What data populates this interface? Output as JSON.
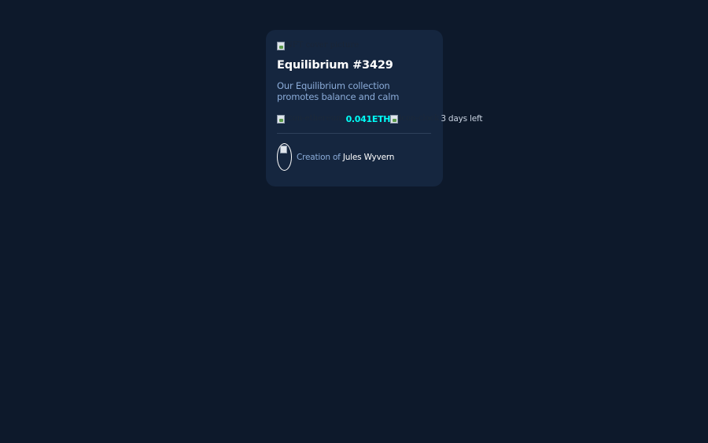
{
  "card": {
    "cover_alt": "NFT cover picture",
    "title": "Equilibrium #3429",
    "description": "Our Equilibrium collection promotes balance and calm",
    "eth_icon_alt": "icon-ethereum",
    "price": "0.041ETH",
    "clock_icon_alt": "icon-clock",
    "time_left": "3 days left",
    "avatar_alt": "avatar",
    "creator_prefix": "Creation of",
    "creator_name": "Jules Wyvern"
  },
  "colors": {
    "background": "#0d192b",
    "card": "#15263f",
    "accent": "#00fff8",
    "muted": "#8bacd9"
  }
}
